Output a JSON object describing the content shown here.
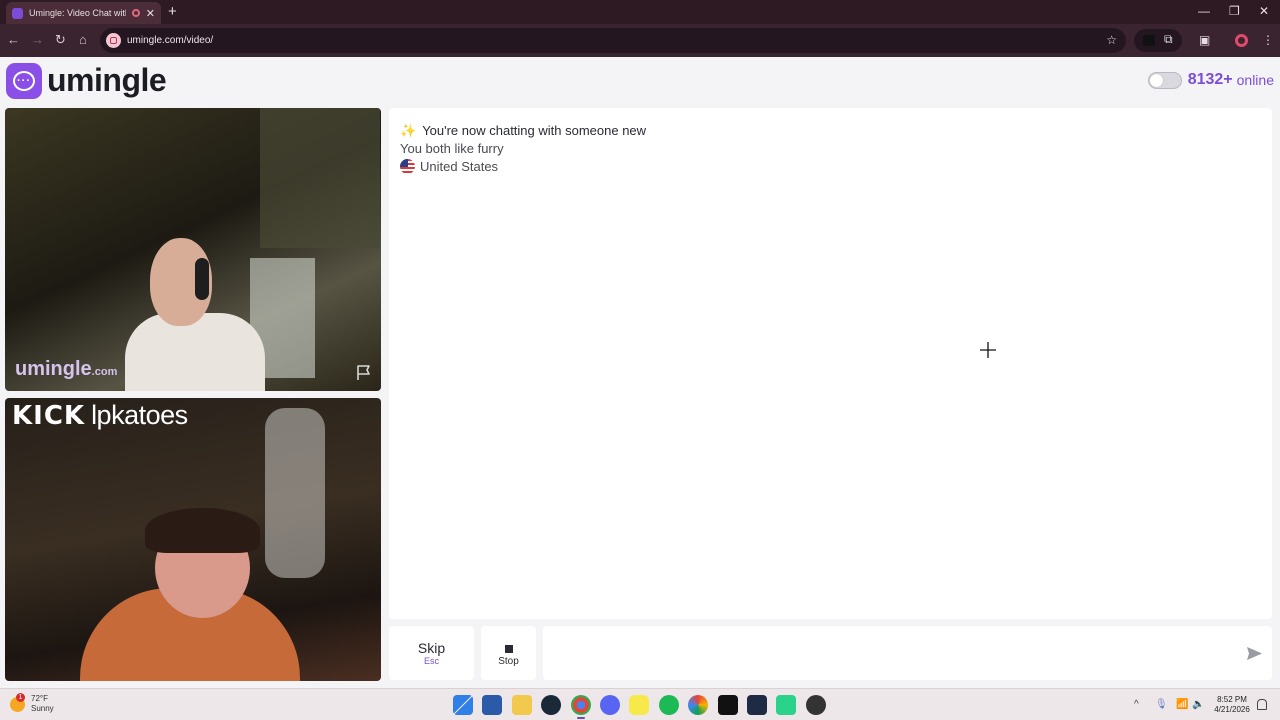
{
  "browser": {
    "tab_title": "Umingle: Video Chat with S",
    "tab_close": "✕",
    "new_tab": "+",
    "url": "umingle.com/video/",
    "window_controls": {
      "minimize": "—",
      "restore": "❐",
      "close": "✕"
    },
    "nav": {
      "back": "←",
      "forward": "→",
      "reload": "↻",
      "home": "⌂"
    },
    "star": "☆"
  },
  "header": {
    "logo_text": "umingle",
    "online_count": "8132+",
    "online_label": "online"
  },
  "videos": {
    "remote_watermark": "umingle",
    "remote_watermark_suffix": ".com",
    "self_kick_logo": "KICK",
    "self_username": "lpkatoes"
  },
  "chat": {
    "messages": [
      {
        "text": "You're now chatting with someone new",
        "icon": "sparkles-icon"
      },
      {
        "text": "You both like furry"
      },
      {
        "text": "United States",
        "icon": "us-flag-icon"
      }
    ]
  },
  "controls": {
    "skip_label": "Skip",
    "skip_shortcut": "Esc",
    "stop_label": "Stop",
    "message_placeholder": ""
  },
  "taskbar": {
    "weather_temp": "72°F",
    "weather_desc": "Sunny",
    "weather_badge": "1",
    "time": "8:52 PM",
    "date": "4/21/2026",
    "tray_chevron": "^"
  },
  "colors": {
    "accent": "#7a4ed9",
    "brand": "#8a4fe6",
    "chrome_dark": "#2d1a23"
  }
}
